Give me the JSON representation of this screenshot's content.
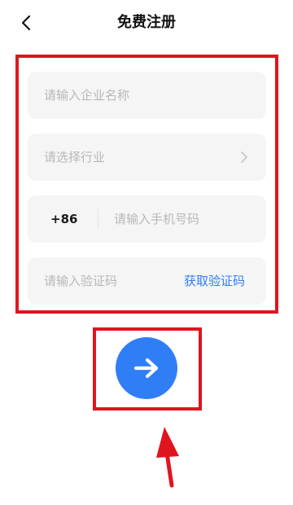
{
  "header": {
    "title": "免费注册",
    "back_icon": "chevron-left-icon"
  },
  "form": {
    "company_name_placeholder": "请输入企业名称",
    "industry_placeholder": "请选择行业",
    "industry_icon": "chevron-right-icon",
    "country_code": "+86",
    "phone_placeholder": "请输入手机号码",
    "verification_placeholder": "请输入验证码",
    "get_code_label": "获取验证码"
  },
  "actions": {
    "next_icon": "arrow-right-icon"
  },
  "colors": {
    "accent": "#2f7ef6",
    "highlight": "#e0141f",
    "field_bg": "#f5f5f5",
    "placeholder": "#b8b8b8"
  }
}
